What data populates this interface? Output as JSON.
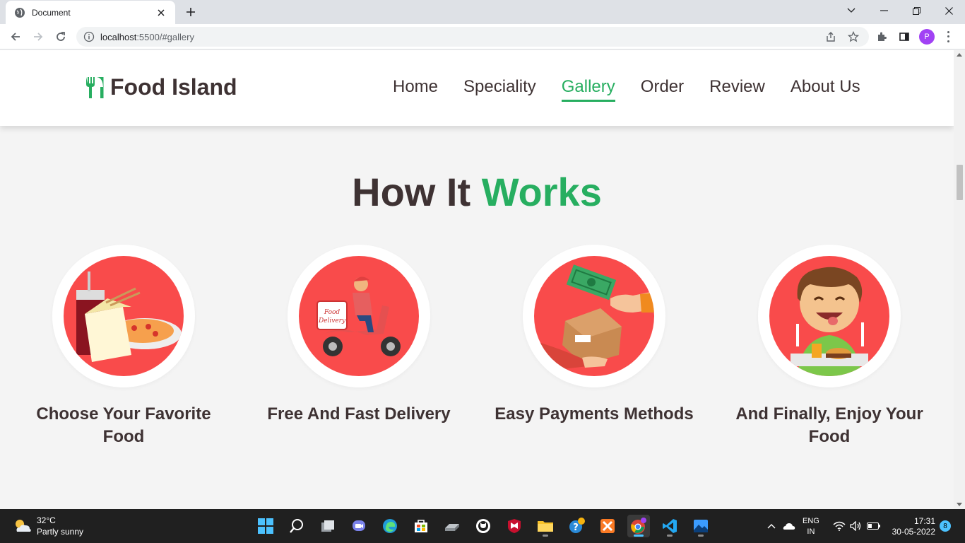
{
  "browser": {
    "tab_title": "Document",
    "url_host": "localhost",
    "url_rest": ":5500/#gallery",
    "profile_initial": "P"
  },
  "site": {
    "logo_text": "Food Island",
    "nav": [
      "Home",
      "Speciality",
      "Gallery",
      "Order",
      "Review",
      "About Us"
    ],
    "active_nav": "Gallery",
    "accent_color": "#27ae60",
    "text_color": "#3e3233"
  },
  "section": {
    "title_part1": "How It",
    "title_part2": "Works",
    "steps": [
      {
        "title": "Choose Your Favorite Food",
        "icon": "food-combo-icon"
      },
      {
        "title": "Free And Fast Delivery",
        "icon": "delivery-scooter-icon"
      },
      {
        "title": "Easy Payments Methods",
        "icon": "payment-package-icon"
      },
      {
        "title": "And Finally, Enjoy Your Food",
        "icon": "happy-eater-icon"
      }
    ]
  },
  "taskbar": {
    "temperature": "32°C",
    "weather": "Partly sunny",
    "lang_1": "ENG",
    "lang_2": "IN",
    "time": "17:31",
    "date": "30-05-2022",
    "notification_count": "8"
  }
}
